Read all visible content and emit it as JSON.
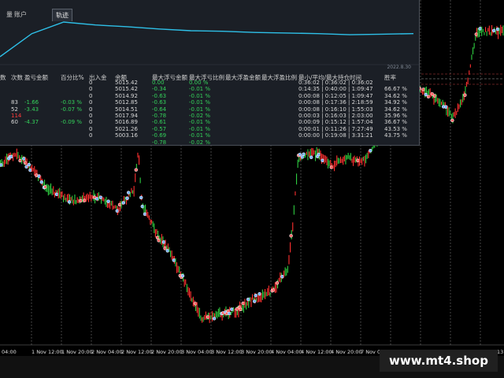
{
  "tabs": [
    {
      "label": "量",
      "active": false
    },
    {
      "label": "账户",
      "active": false
    },
    {
      "label": "轨迹",
      "active": true
    }
  ],
  "equity": {
    "date_label": "2022.8.30",
    "points": [
      0,
      40,
      60,
      55,
      52,
      48,
      45,
      44,
      42,
      41,
      40,
      38,
      39,
      40
    ],
    "color": "#2ec0e8"
  },
  "table": {
    "headers": [
      "数",
      "次数",
      "盈亏金额",
      "百分比%",
      "出入金",
      "余额",
      "最大浮亏金额",
      "最大浮亏比例",
      "最大浮盈金额",
      "最大浮盈比例",
      "最小/平均/最大持仓时间",
      "胜率"
    ],
    "rows": [
      [
        "",
        "",
        "",
        "",
        "0",
        "5015.42",
        "0.00",
        "0.00 %",
        "",
        "",
        "0:36:02 | 0:36:02 | 0:36:02",
        ""
      ],
      [
        "",
        "",
        "",
        "",
        "0",
        "5015.42",
        "-0.34",
        "-0.01 %",
        "",
        "",
        "0:14:35 | 0:40:00 | 1:09:47",
        "66.67 %"
      ],
      [
        "",
        "",
        "",
        "",
        "0",
        "5014.92",
        "-0.63",
        "-0.01 %",
        "",
        "",
        "0:00:08 | 0:12:05 | 1:09:47",
        "34.62 %"
      ],
      [
        "",
        "83",
        "-1.66",
        "-0.03 %",
        "0",
        "5012.85",
        "-0.63",
        "-0.01 %",
        "",
        "",
        "0:00:08 | 0:17:36 | 2:18:59",
        "34.92 %"
      ],
      [
        "",
        "52",
        "-3.43",
        "-0.07 %",
        "0",
        "5014.51",
        "-0.64",
        "-0.01 %",
        "",
        "",
        "0:00:08 | 0:16:10 | 1:55:03",
        "34.62 %"
      ],
      [
        "",
        "114",
        "",
        "",
        "0",
        "5017.94",
        "-0.78",
        "-0.02 %",
        "",
        "",
        "0:00:03 | 0:16:03 | 2:03:00",
        "35.96 %"
      ],
      [
        "",
        "60",
        "-4.37",
        "-0.09 %",
        "0",
        "5016.89",
        "-0.61",
        "-0.01 %",
        "",
        "",
        "0:00:09 | 0:15:12 | 1:57:04",
        "36.67 %"
      ],
      [
        "",
        "",
        "",
        "",
        "0",
        "5021.26",
        "-0.57",
        "-0.01 %",
        "",
        "",
        "0:00:01 | 0:11:26 | 7:27:49",
        "43.53 %"
      ],
      [
        "",
        "",
        "",
        "",
        "0",
        "5003.16",
        "-0.69",
        "-0.01 %",
        "",
        "",
        "0:00:00 | 0:19:08 | 3:31:21",
        "43.75 %"
      ],
      [
        "",
        "",
        "",
        "",
        "",
        "",
        "-0.78",
        "-0.02 %",
        "",
        "",
        "",
        ""
      ]
    ]
  },
  "time_axis": [
    "04:00",
    "1 Nov 12:00",
    "1 Nov 20:00",
    "2 Nov 04:00",
    "2 Nov 12:00",
    "2 Nov 20:00",
    "3 Nov 04:00",
    "3 Nov 12:00",
    "3 Nov 20:00",
    "4 Nov 04:00",
    "4 Nov 12:00",
    "4 Nov 20:00",
    "7 Nov 05:00",
    "7 Nov 13:00",
    "7 Nov 21:00",
    "8 Nov 05:00",
    "8 Nov 13"
  ],
  "watermark": "www.mt4.shop",
  "colors": {
    "up": "#2ecc40",
    "down": "#ff3030",
    "equity": "#2ec0e8",
    "panel": "#1b1f26"
  }
}
